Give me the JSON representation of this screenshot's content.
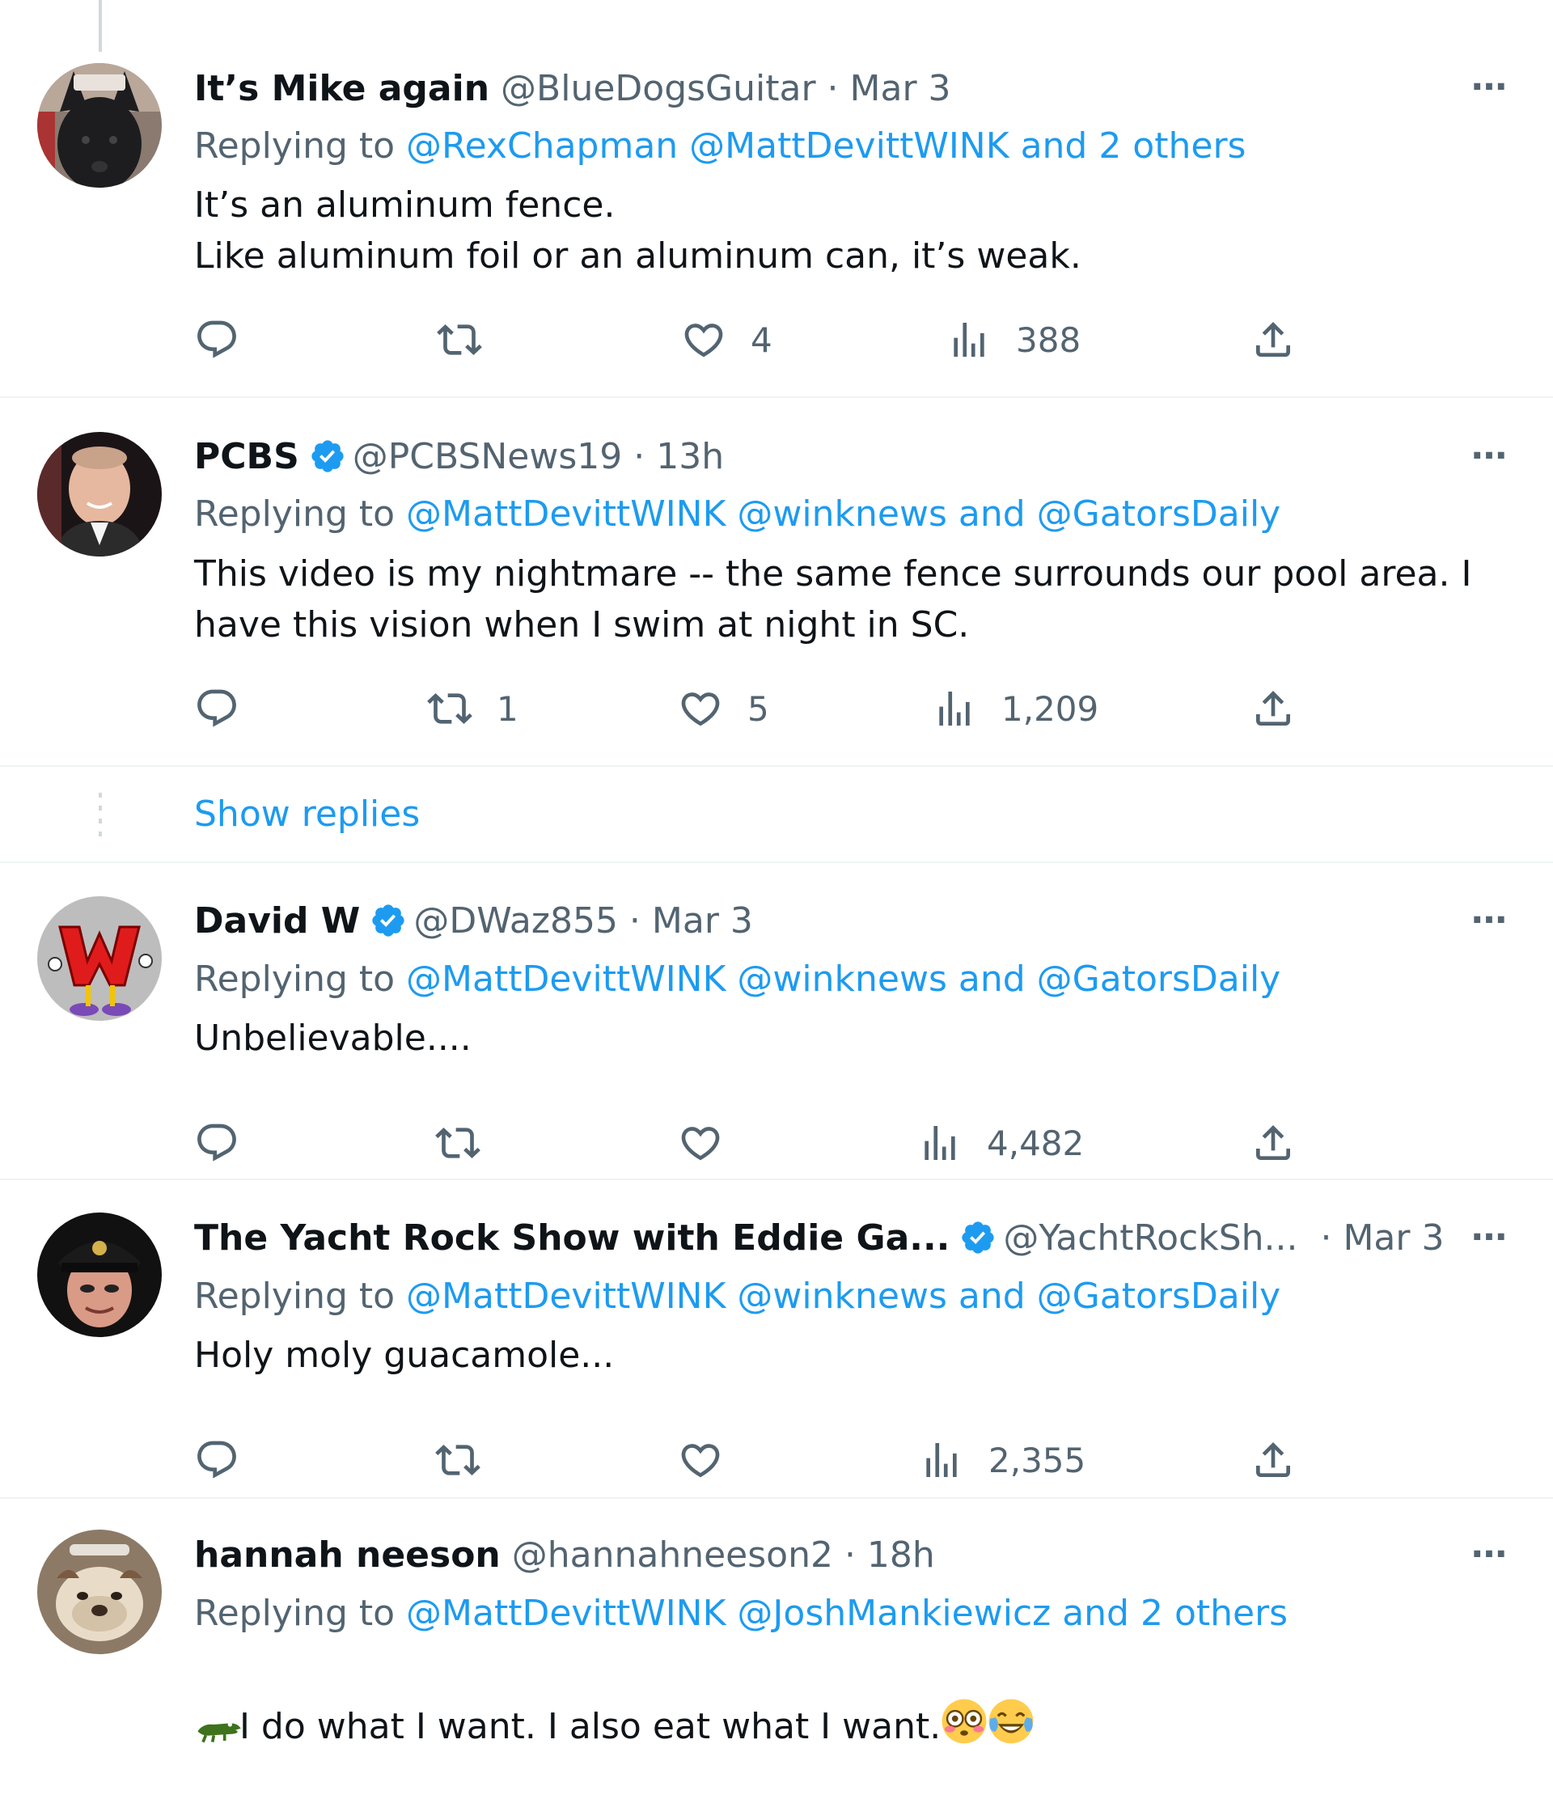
{
  "tweets": [
    {
      "name": "It’s Mike again",
      "handle": "@BlueDogsGuitar · Mar 3",
      "replying_prefix": "Replying to ",
      "replying_links": "@RexChapman @MattDevittWINK and 2 others",
      "text": "It’s an aluminum fence.\nLike aluminum foil or an aluminum can, it’s weak.",
      "replies": "",
      "retweets": "",
      "likes": "4",
      "views": "388"
    },
    {
      "name": "PCBS",
      "handle": "@PCBSNews19 · 13h",
      "replying_prefix": "Replying to ",
      "replying_links": "@MattDevittWINK @winknews and @GatorsDaily",
      "text": "This video is my nightmare -- the same fence surrounds our pool area. I\nhave this vision when I swim at night in SC.",
      "replies": "",
      "retweets": "1",
      "likes": "5",
      "views": "1,209"
    },
    {
      "name": "David W",
      "handle": "@DWaz855 · Mar 3",
      "replying_prefix": "Replying to ",
      "replying_links": "@MattDevittWINK @winknews and @GatorsDaily",
      "text": "Unbelievable....",
      "replies": "",
      "retweets": "",
      "likes": "",
      "views": "4,482"
    },
    {
      "name": "The Yacht Rock Show with Eddie Ga...",
      "handle": "@YachtRockSh...",
      "time": " · Mar 3",
      "replying_prefix": "Replying to ",
      "replying_links": "@MattDevittWINK @winknews and @GatorsDaily",
      "text": "Holy moly guacamole...",
      "replies": "",
      "retweets": "",
      "likes": "",
      "views": "2,355"
    },
    {
      "name": "hannah neeson",
      "handle": "@hannahneeson2 · 18h",
      "replying_prefix": "Replying to ",
      "replying_links": "@MattDevittWINK @JoshMankiewicz and 2 others",
      "text": "I do what I want. I also eat what I want."
    }
  ],
  "show_replies": "Show replies",
  "more_label": "···",
  "colors": {
    "link": "#1d9bf0",
    "secondary": "#536471",
    "text": "#0f1419",
    "divider": "#eff3f4",
    "verified": "#1d9bf0"
  },
  "icons": [
    "reply-icon",
    "retweet-icon",
    "like-icon",
    "views-icon",
    "share-icon",
    "more-icon",
    "verified-badge-icon",
    "flushed-face-emoji",
    "tears-of-joy-emoji",
    "crocodile-emoji"
  ]
}
